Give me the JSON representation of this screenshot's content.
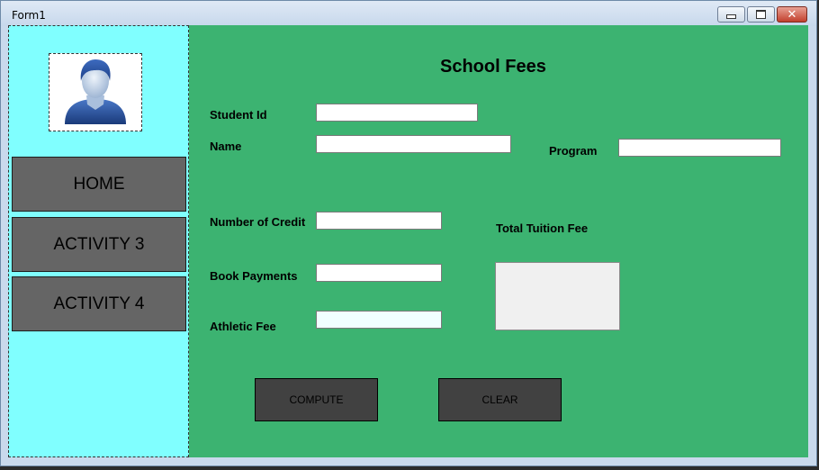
{
  "window": {
    "title": "Form1"
  },
  "sidebar": {
    "avatar_icon": "user-avatar-icon",
    "nav": [
      {
        "label": "HOME"
      },
      {
        "label": "ACTIVITY 3"
      },
      {
        "label": "ACTIVITY 4"
      }
    ]
  },
  "form": {
    "heading": "School Fees",
    "student_id": {
      "label": "Student Id",
      "value": ""
    },
    "name": {
      "label": "Name",
      "value": ""
    },
    "program": {
      "label": "Program",
      "value": ""
    },
    "credits": {
      "label": "Number of Credit",
      "value": ""
    },
    "book_payments": {
      "label": "Book Payments",
      "value": ""
    },
    "athletic_fee": {
      "label": "Athletic Fee",
      "value": ""
    },
    "total_tuition": {
      "label": "Total Tuition Fee",
      "value": ""
    },
    "compute_label": "COMPUTE",
    "clear_label": "CLEAR"
  },
  "colors": {
    "form_bg": "#3cb371",
    "sidebar_bg": "#80ffff",
    "button_bg": "#656565"
  }
}
